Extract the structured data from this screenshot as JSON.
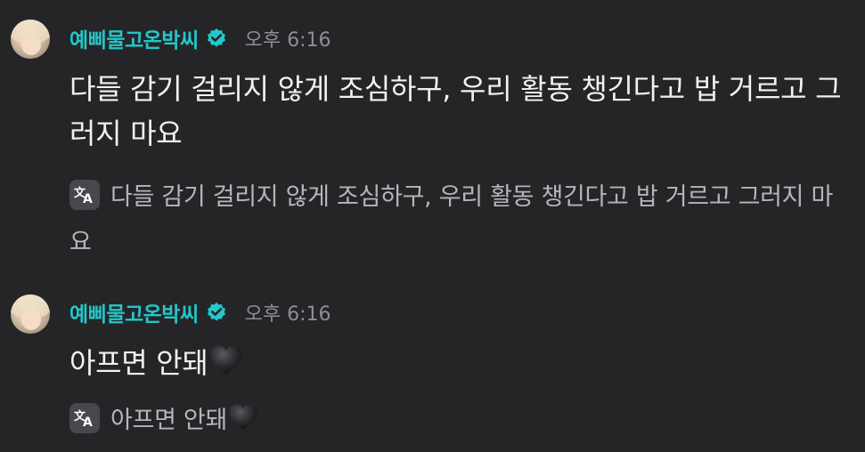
{
  "colors": {
    "background": "#252527",
    "username": "#23c6c8",
    "timestamp": "#8d8d93",
    "body_text": "#f1f1f3",
    "translation_text": "#b5b5ba",
    "verified_badge": "#21c9cc"
  },
  "messages": [
    {
      "username": "예삐물고온박씨",
      "verified": true,
      "timestamp": "오후 6:16",
      "text": "다들 감기 걸리지 않게 조심하구, 우리 활동 챙긴다고 밥 거르고 그러지 마요",
      "translation": "다들 감기 걸리지 않게 조심하구, 우리 활동 챙긴다고 밥 거르고 그러지 마요",
      "icons": [
        "avatar",
        "verified-badge-icon",
        "translate-icon"
      ]
    },
    {
      "username": "예삐물고온박씨",
      "verified": true,
      "timestamp": "오후 6:16",
      "text": "아프면 안돼",
      "emoji": "black-heart",
      "translation": "아프면 안돼",
      "icons": [
        "avatar",
        "verified-badge-icon",
        "translate-icon",
        "black-heart-icon"
      ]
    }
  ]
}
